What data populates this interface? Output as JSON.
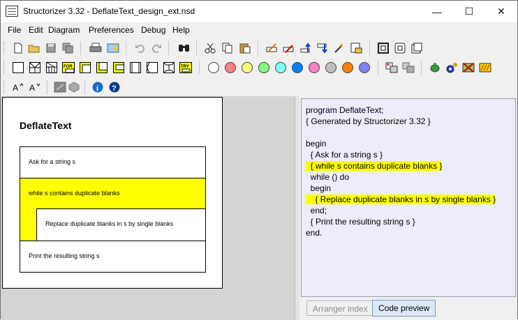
{
  "window": {
    "title": "Structorizer 3.32 - DeflateText_design_ext.nsd",
    "minimize_glyph": "—",
    "maximize_glyph": "☐",
    "close_glyph": "✕"
  },
  "menu": {
    "items": [
      "File",
      "Edit",
      "Diagram",
      "Preferences",
      "Debug",
      "Help"
    ]
  },
  "diagram": {
    "title": "DeflateText",
    "elements": [
      "Ask for a string s",
      "while s contains duplicate blanks",
      "Replace duplicate blanks in s by single blanks",
      "Print the resulting string s"
    ]
  },
  "code_preview": {
    "lines": [
      {
        "text": "program DeflateText;",
        "hl": false
      },
      {
        "text": "{ Generated by Structorizer 3.32 }",
        "hl": false
      },
      {
        "text": "",
        "hl": false
      },
      {
        "text": "begin",
        "hl": false
      },
      {
        "text": "  { Ask for a string s }",
        "hl": false
      },
      {
        "text": "  { while s contains duplicate blanks }",
        "hl": true
      },
      {
        "text": "  while () do",
        "hl": false
      },
      {
        "text": "  begin",
        "hl": false
      },
      {
        "text": "    { Replace duplicate blanks in s by single blanks }",
        "hl": true
      },
      {
        "text": "  end;",
        "hl": false
      },
      {
        "text": "  { Print the resulting string s }",
        "hl": false
      },
      {
        "text": "end.",
        "hl": false
      }
    ]
  },
  "tabs": {
    "arranger": "Arranger index",
    "code": "Code preview"
  },
  "toolbar_icons": {
    "row1": [
      "new-file-icon",
      "open-folder-icon",
      "save-icon",
      "save-all-icon",
      "print-icon",
      "export-picture-icon",
      "undo-icon",
      "redo-icon",
      "find-icon",
      "cut-icon",
      "copy-icon",
      "paste-icon",
      "edit-element-icon",
      "delete-element-icon",
      "move-up-icon",
      "move-down-icon",
      "transmute-icon",
      "collapse-icon",
      "view-mode-1-icon",
      "view-mode-2-icon",
      "view-mode-3-icon"
    ],
    "row2_structures": [
      "instruction-icon",
      "if-icon",
      "case-icon",
      "for-icon",
      "while-icon",
      "repeat-icon",
      "forever-icon",
      "call-icon",
      "jump-icon",
      "parallel-icon",
      "try-icon"
    ],
    "row2_colors": [
      "#ffffff",
      "#ff8080",
      "#ffff80",
      "#80ff80",
      "#80ffff",
      "#0080ff",
      "#ff80c0",
      "#c0c0c0",
      "#ff8000",
      "#8080ff"
    ],
    "row3": [
      "font-up-icon",
      "font-down-icon",
      "toggle-a-icon",
      "toggle-b-icon",
      "info-icon",
      "help-icon"
    ]
  },
  "colors": {
    "highlight": "#ffff00",
    "code_bg": "#ececfa"
  }
}
